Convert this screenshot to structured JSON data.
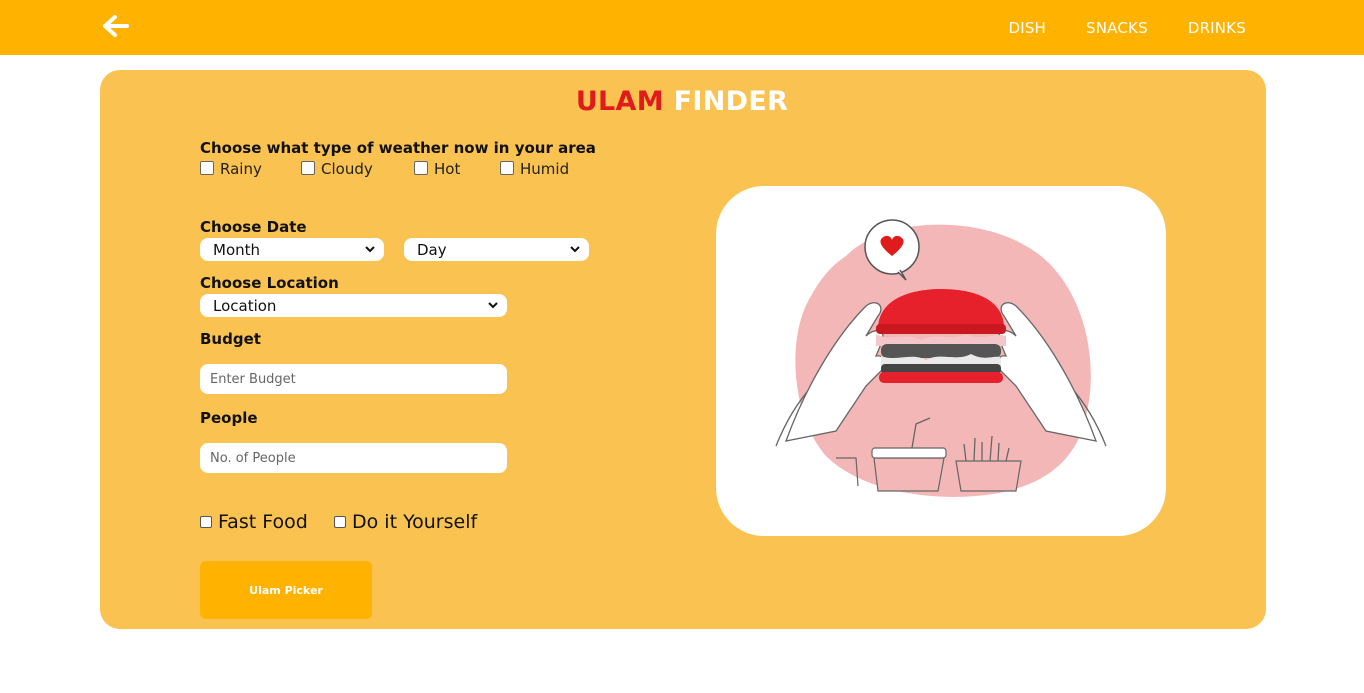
{
  "header": {
    "nav": [
      "DISH",
      "SNACKS",
      "DRINKS"
    ]
  },
  "title": {
    "part1": "ULAM",
    "part2": "FINDER"
  },
  "weather": {
    "label": "Choose what type of weather now in your area",
    "options": [
      "Rainy",
      "Cloudy",
      "Hot",
      "Humid"
    ]
  },
  "date": {
    "label": "Choose Date",
    "month": "Month",
    "day": "Day"
  },
  "location": {
    "label": "Choose Location",
    "value": "Location"
  },
  "budget": {
    "label": "Budget",
    "placeholder": "Enter Budget"
  },
  "people": {
    "label": "People",
    "placeholder": "No. of People"
  },
  "type_options": [
    "Fast Food",
    "Do it Yourself"
  ],
  "submit_label": "Ulam Picker",
  "colors": {
    "header": "#ffb300",
    "card": "#fac250",
    "accent_red": "#e01b1b",
    "button": "#ffb300"
  },
  "illustration": {
    "icon": "burger-illustration"
  }
}
